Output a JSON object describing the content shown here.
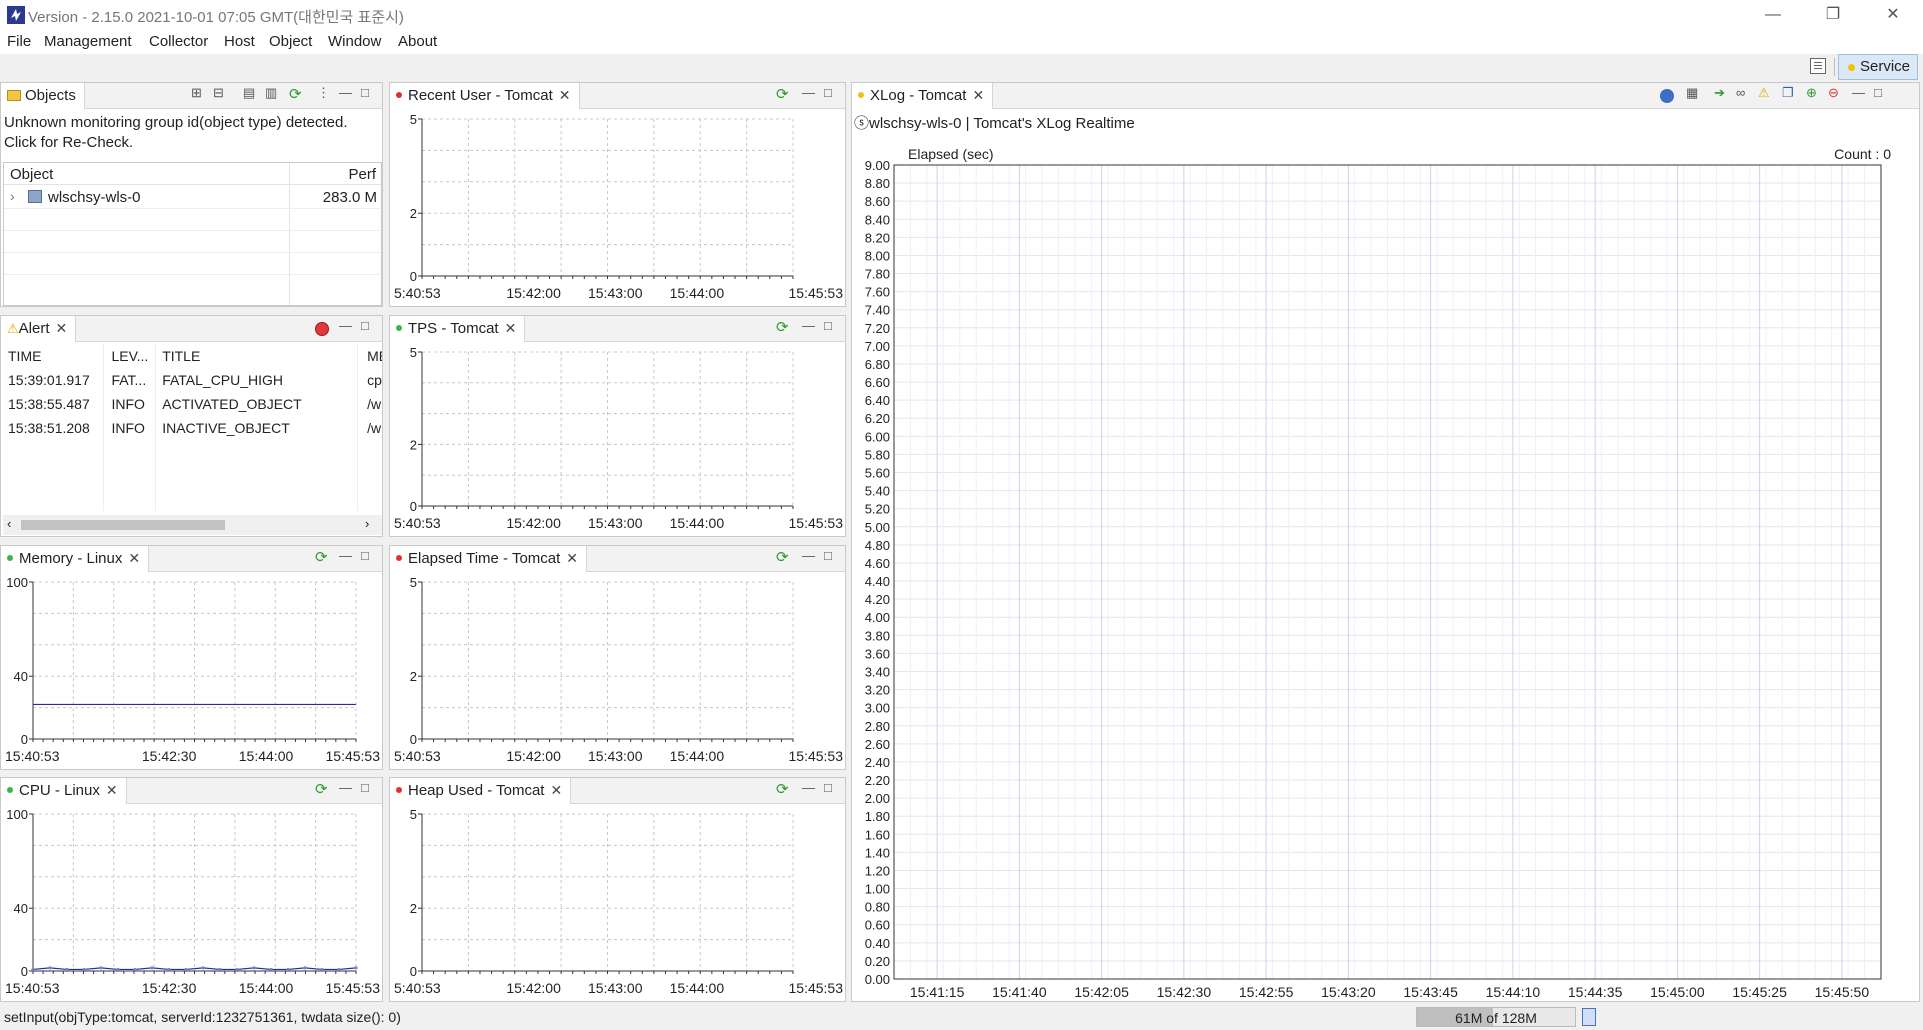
{
  "window": {
    "title": "Version - 2.15.0 2021-10-01 07:05 GMT(대한민국 표준시)",
    "minimize": "—",
    "restore": "❐",
    "close": "✕"
  },
  "menu": [
    "File",
    "Management",
    "Collector",
    "Host",
    "Object",
    "Window",
    "About"
  ],
  "perspective": {
    "label": "Service"
  },
  "objects": {
    "tab": "Objects",
    "warning": "Unknown monitoring group id(object type) detected.",
    "warning2": "Click for Re-Check.",
    "columns": [
      "Object",
      "Perf"
    ],
    "rows": [
      {
        "name": "wlschsy-wls-0",
        "perf": "283.0 M"
      }
    ]
  },
  "alert": {
    "tab": "Alert",
    "columns": [
      "TIME",
      "LEV...",
      "TITLE",
      "ME"
    ],
    "rows": [
      {
        "time": "15:39:01.917",
        "level": "FAT...",
        "title": "FATAL_CPU_HIGH",
        "msg": "cpu"
      },
      {
        "time": "15:38:55.487",
        "level": "INFO",
        "title": "ACTIVATED_OBJECT",
        "msg": "/wl"
      },
      {
        "time": "15:38:51.208",
        "level": "INFO",
        "title": "INACTIVE_OBJECT",
        "msg": "/wl"
      }
    ]
  },
  "views": {
    "recent_user": "Recent User - Tomcat",
    "tps": "TPS - Tomcat",
    "elapsed": "Elapsed Time - Tomcat",
    "heap": "Heap Used - Tomcat",
    "memory": "Memory - Linux",
    "cpu": "CPU - Linux",
    "xlog": "XLog - Tomcat"
  },
  "xlog": {
    "subtitle": "ⓢwlschsy-wls-0 | Tomcat's XLog Realtime",
    "ylabel": "Elapsed (sec)",
    "count": "Count : 0"
  },
  "status": {
    "message": "setInput(objType:tomcat, serverId:1232751361, twdata size(): 0)",
    "heap": "61M of 128M",
    "heap_used_fraction": 0.48
  },
  "colors": {
    "live_dot": "#3cb44b",
    "dead_dot": "#e03030",
    "idle_dot": "#e8c21c",
    "series": "#2a2aa0"
  },
  "chart_data": [
    {
      "id": "recent_user",
      "type": "line",
      "title": "Recent User - Tomcat",
      "ylim": [
        0,
        5
      ],
      "yticks": [
        0,
        2,
        5
      ],
      "xticks": [
        "5:40:53",
        "15:42:00",
        "15:43:00",
        "15:44:00",
        "15:45:53"
      ],
      "series": [
        {
          "values": []
        }
      ],
      "grid": true
    },
    {
      "id": "tps",
      "type": "line",
      "title": "TPS - Tomcat",
      "ylim": [
        0,
        5
      ],
      "yticks": [
        0,
        2,
        5
      ],
      "xticks": [
        "5:40:53",
        "15:42:00",
        "15:43:00",
        "15:44:00",
        "15:45:53"
      ],
      "series": [
        {
          "values": []
        }
      ],
      "grid": true
    },
    {
      "id": "elapsed",
      "type": "line",
      "title": "Elapsed Time - Tomcat",
      "ylim": [
        0,
        5
      ],
      "yticks": [
        0,
        2,
        5
      ],
      "xticks": [
        "5:40:53",
        "15:42:00",
        "15:43:00",
        "15:44:00",
        "15:45:53"
      ],
      "series": [
        {
          "values": []
        }
      ],
      "grid": true
    },
    {
      "id": "heap",
      "type": "line",
      "title": "Heap Used - Tomcat",
      "ylim": [
        0,
        5
      ],
      "yticks": [
        0,
        2,
        5
      ],
      "xticks": [
        "5:40:53",
        "15:42:00",
        "15:43:00",
        "15:44:00",
        "15:45:53"
      ],
      "series": [
        {
          "values": []
        }
      ],
      "grid": true
    },
    {
      "id": "memory",
      "type": "line",
      "title": "Memory - Linux",
      "ylim": [
        0,
        100
      ],
      "yticks": [
        0,
        40,
        100
      ],
      "xticks": [
        "15:40:53",
        "15:42:30",
        "15:44:00",
        "15:45:53"
      ],
      "series": [
        {
          "values": [
            22,
            22,
            22,
            22,
            22,
            22,
            22,
            22,
            22,
            22
          ]
        }
      ],
      "grid": true
    },
    {
      "id": "cpu",
      "type": "line",
      "title": "CPU - Linux",
      "ylim": [
        0,
        100
      ],
      "yticks": [
        0,
        40,
        100
      ],
      "xticks": [
        "15:40:53",
        "15:42:30",
        "15:44:00",
        "15:45:53"
      ],
      "series": [
        {
          "values": [
            1,
            2,
            1,
            1,
            2,
            1,
            1,
            2,
            1,
            1,
            2,
            1,
            1,
            2,
            1,
            1,
            2,
            1,
            1,
            2
          ]
        }
      ],
      "grid": true
    },
    {
      "id": "xlog",
      "type": "scatter",
      "title": "XLog - Tomcat",
      "ylabel": "Elapsed (sec)",
      "ylim": [
        0,
        9
      ],
      "yticks": [
        "0.00",
        "0.20",
        "0.40",
        "0.60",
        "0.80",
        "1.00",
        "1.20",
        "1.40",
        "1.60",
        "1.80",
        "2.00",
        "2.20",
        "2.40",
        "2.60",
        "2.80",
        "3.00",
        "3.20",
        "3.40",
        "3.60",
        "3.80",
        "4.00",
        "4.20",
        "4.40",
        "4.60",
        "4.80",
        "5.00",
        "5.20",
        "5.40",
        "5.60",
        "5.80",
        "6.00",
        "6.20",
        "6.40",
        "6.60",
        "6.80",
        "7.00",
        "7.20",
        "7.40",
        "7.60",
        "7.80",
        "8.00",
        "8.20",
        "8.40",
        "8.60",
        "8.80",
        "9.00"
      ],
      "xticks": [
        "15:41:15",
        "15:41:40",
        "15:42:05",
        "15:42:30",
        "15:42:55",
        "15:43:20",
        "15:43:45",
        "15:44:10",
        "15:44:35",
        "15:45:00",
        "15:45:25",
        "15:45:50"
      ],
      "points": [],
      "grid": true
    }
  ]
}
